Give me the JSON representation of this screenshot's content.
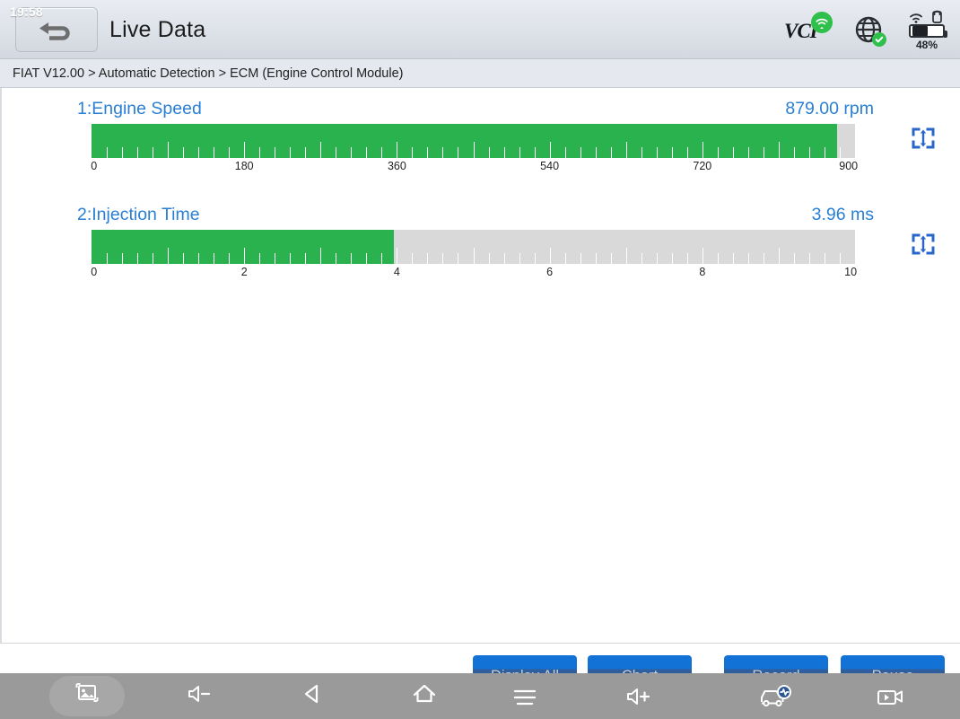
{
  "titlebar": {
    "clock": "19:58",
    "title": "Live Data",
    "back_icon": "back-arrow-icon",
    "vci_label": "VCI",
    "vci_status_icon": "wifi-connected-icon",
    "globe_icon": "globe-icon",
    "globe_status_icon": "check-icon",
    "battery_percent": "48%",
    "battery_level": 48
  },
  "breadcrumb": {
    "text": "FIAT V12.00 > Automatic Detection  > ECM (Engine Control Module)"
  },
  "live_data": {
    "items": [
      {
        "index": "1",
        "name": "1:Engine Speed",
        "value": "879.00 rpm",
        "numeric_value": 879.0,
        "unit": "rpm",
        "min": 0,
        "max": 900,
        "fill_percent": 97.7,
        "axis_labels": [
          "0",
          "180",
          "360",
          "540",
          "720",
          "900"
        ],
        "expand_icon": "expand-vertical-icon"
      },
      {
        "index": "2",
        "name": "2:Injection Time",
        "value": "3.96 ms",
        "numeric_value": 3.96,
        "unit": "ms",
        "min": 0,
        "max": 10,
        "fill_percent": 39.6,
        "axis_labels": [
          "0",
          "2",
          "4",
          "6",
          "8",
          "10"
        ],
        "expand_icon": "expand-vertical-icon"
      }
    ]
  },
  "toolbar": {
    "buttons": [
      {
        "label": "Display All",
        "name": "display-all-button"
      },
      {
        "label": "Chart",
        "name": "chart-button"
      },
      {
        "label": "Record",
        "name": "record-button"
      },
      {
        "label": "Pause",
        "name": "pause-button"
      }
    ]
  },
  "navbar": {
    "items": [
      {
        "icon": "screenshot-icon",
        "name": "nav-screenshot",
        "active": true
      },
      {
        "icon": "volume-down-icon",
        "name": "nav-volume-down",
        "active": false
      },
      {
        "icon": "back-triangle-icon",
        "name": "nav-back",
        "active": false
      },
      {
        "icon": "home-icon",
        "name": "nav-home",
        "active": false
      }
    ],
    "overlay_icons": [
      "menu-lines-icon",
      "volume-up-icon",
      "record-car-icon",
      "video-play-icon"
    ]
  },
  "colors": {
    "accent_blue": "#2a7fd4",
    "bar_green": "#2ab24f",
    "bar_track": "#d9d9d9",
    "button_blue": "#2a5691",
    "status_green": "#2fbf4b"
  }
}
